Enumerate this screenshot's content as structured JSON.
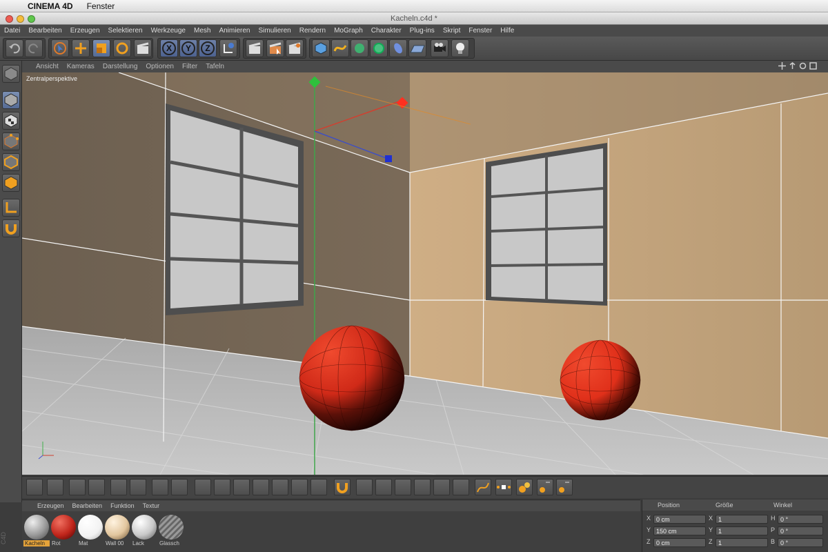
{
  "mac_menu": {
    "app_name": "CINEMA 4D",
    "items": [
      "Fenster"
    ]
  },
  "window": {
    "title": "Kacheln.c4d *"
  },
  "main_menu": [
    "Datei",
    "Bearbeiten",
    "Erzeugen",
    "Selektieren",
    "Werkzeuge",
    "Mesh",
    "Animieren",
    "Simulieren",
    "Rendern",
    "MoGraph",
    "Charakter",
    "Plug-ins",
    "Skript",
    "Fenster",
    "Hilfe"
  ],
  "toolbar": {
    "axis_x": "X",
    "axis_y": "Y",
    "axis_z": "Z"
  },
  "viewport_menu": [
    "Ansicht",
    "Kameras",
    "Darstellung",
    "Optionen",
    "Filter",
    "Tafeln"
  ],
  "viewport": {
    "label": "Zentralperspektive"
  },
  "material_menu": [
    "Erzeugen",
    "Bearbeiten",
    "Funktion",
    "Textur"
  ],
  "materials": [
    {
      "name": "Kacheln",
      "color": "#9a9a9a",
      "selected": true
    },
    {
      "name": "Rot",
      "color": "#c0251b",
      "selected": false
    },
    {
      "name": "Mat",
      "color": "#f2f2f2",
      "selected": false
    },
    {
      "name": "Wall 00",
      "color": "#e2c69e",
      "selected": false
    },
    {
      "name": "Lack",
      "color": "#c8c8c8",
      "selected": false
    },
    {
      "name": "Glassch",
      "color": "#8a8a8a",
      "selected": false
    }
  ],
  "coordinates": {
    "headers": {
      "position": "Position",
      "size": "Größe",
      "rotation": "Winkel"
    },
    "rows": [
      {
        "axis": "X",
        "pos": "0 cm",
        "size_axis": "X",
        "size": "1",
        "rot_axis": "H",
        "rot": "0 °"
      },
      {
        "axis": "Y",
        "pos": "150 cm",
        "size_axis": "Y",
        "size": "1",
        "rot_axis": "P",
        "rot": "0 °"
      },
      {
        "axis": "Z",
        "pos": "0 cm",
        "size_axis": "Z",
        "size": "1",
        "rot_axis": "B",
        "rot": "0 °"
      }
    ]
  },
  "side_logo": "C4D",
  "colors": {
    "accent": "#e5a33a",
    "wall_left": "#736656",
    "wall_right": "#c7a67e",
    "sphere": "#d8301c"
  }
}
